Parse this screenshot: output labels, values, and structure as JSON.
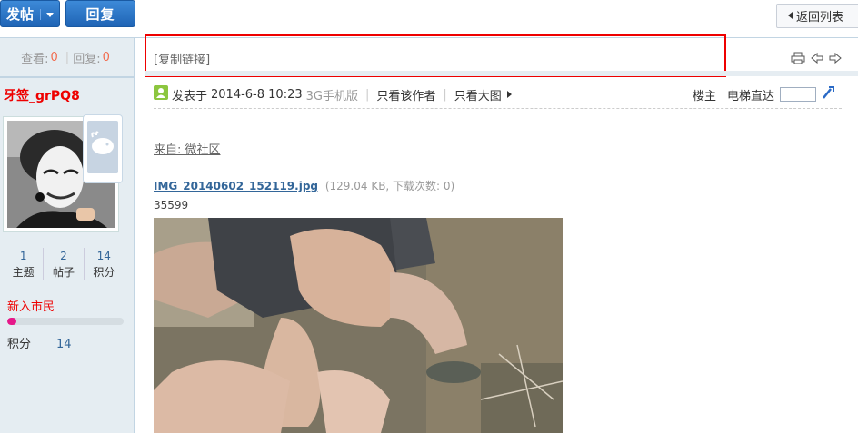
{
  "toolbar": {
    "post_label": "发帖",
    "reply_label": "回复",
    "back_label": "返回列表"
  },
  "thread_stats": {
    "views_label": "查看:",
    "views": "0",
    "replies_label": "回复:",
    "replies": "0"
  },
  "author": {
    "name": "牙签_grPQ8",
    "stats": [
      {
        "value": "1",
        "label": "主题"
      },
      {
        "value": "2",
        "label": "帖子"
      },
      {
        "value": "14",
        "label": "积分"
      }
    ],
    "rank": "新入市民",
    "rank_progress": 0.08,
    "credits_label": "积分",
    "credits": "14"
  },
  "header": {
    "copy_link": "[复制链接]"
  },
  "post": {
    "posted_prefix": "发表于",
    "posted_time": "2014-6-8 10:23",
    "source": "3G手机版",
    "only_author": "只看该作者",
    "only_big_image": "只看大图",
    "floor_label": "楼主",
    "elevator_label": "电梯直达",
    "from": "来自: 微社区",
    "attachment_name": "IMG_20140602_152119.jpg",
    "attachment_info": "(129.04 KB, 下载次数: 0)",
    "attachment_id": "35599"
  },
  "colors": {
    "brand_blue": "#1f64b5",
    "highlight_red": "#e00000",
    "sidebar_bg": "#e5edf2"
  },
  "icons": [
    "chevron-down-icon",
    "back-arrow-icon",
    "print-icon",
    "prev-icon",
    "next-icon",
    "user-icon",
    "go-icon",
    "weibo-icon"
  ]
}
